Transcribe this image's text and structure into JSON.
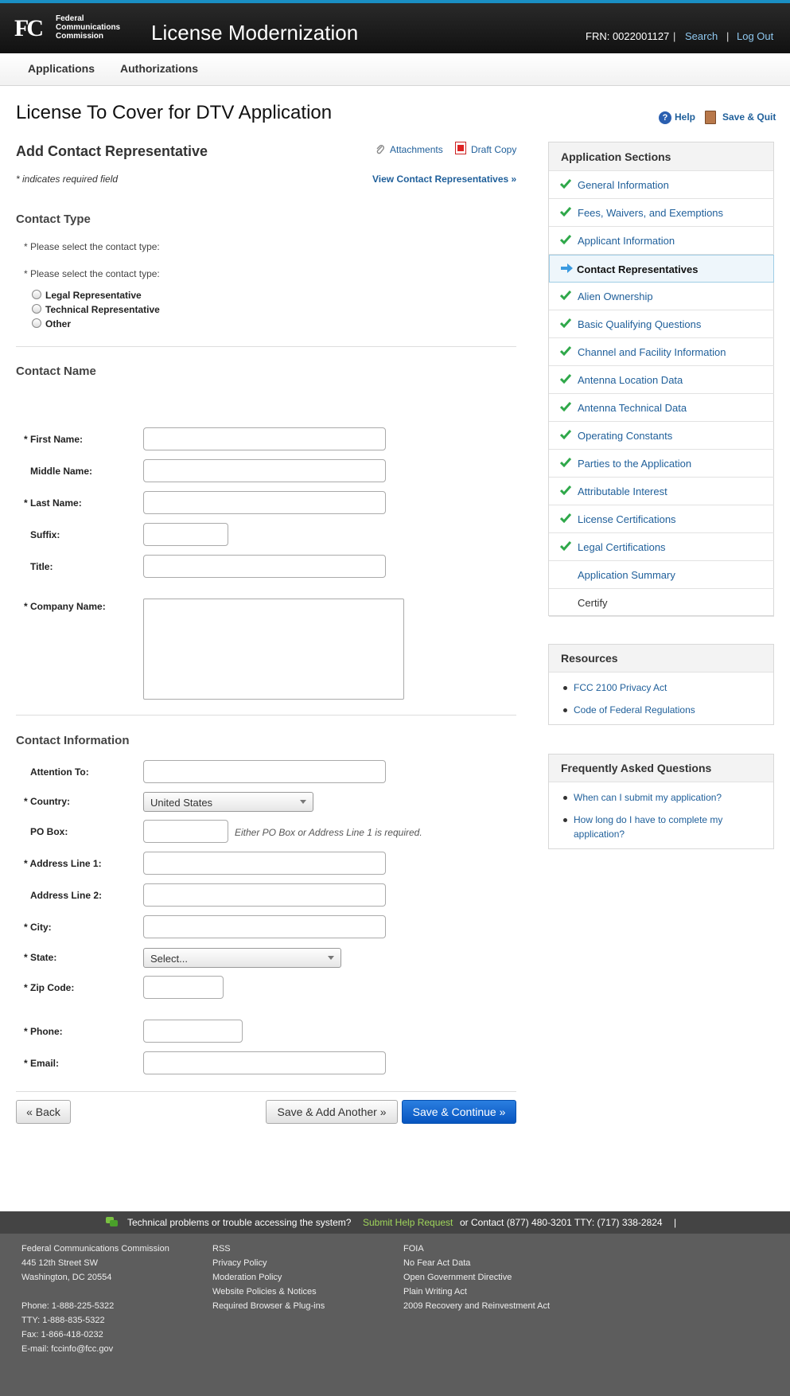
{
  "header": {
    "logo_mark": "FC",
    "logo_text": [
      "Federal",
      "Communications",
      "Commission"
    ],
    "app_title": "License Modernization",
    "frn": "FRN: 0022001127",
    "separator": "|",
    "search": "Search",
    "logout": "Log Out"
  },
  "nav": {
    "applications": "Applications",
    "authorizations": "Authorizations"
  },
  "page": {
    "title": "License To Cover for DTV Application",
    "help": "Help",
    "save_quit": "Save & Quit"
  },
  "form": {
    "heading": "Add Contact Representative",
    "attachments": "Attachments",
    "draft_copy": "Draft Copy",
    "required_note": "* indicates required field",
    "view_reps": "View Contact Representatives »",
    "contact_type": {
      "title": "Contact Type",
      "prompt1": "* Please select the contact type:",
      "prompt2": "* Please select the contact type:",
      "options": [
        "Legal Representative",
        "Technical Representative",
        "Other"
      ]
    },
    "contact_name": {
      "title": "Contact Name",
      "first": "* First Name:",
      "middle": "Middle Name:",
      "last": "* Last Name:",
      "suffix": "Suffix:",
      "title_lbl": "Title:",
      "company": "* Company Name:"
    },
    "contact_info": {
      "title": "Contact Information",
      "attention": "Attention To:",
      "country": "* Country:",
      "country_value": "United States",
      "pobox": "PO Box:",
      "pobox_hint": "Either PO Box or Address Line 1 is required.",
      "addr1": "* Address Line 1:",
      "addr2": "Address Line 2:",
      "city": "* City:",
      "state": "* State:",
      "state_value": "Select...",
      "zip": "* Zip Code:",
      "phone": "* Phone:",
      "email": "* Email:"
    },
    "buttons": {
      "back": "« Back",
      "save_add": "Save & Add Another »",
      "save_continue": "Save & Continue »"
    }
  },
  "sidebar": {
    "sections_title": "Application Sections",
    "sections": [
      {
        "label": "General Information",
        "state": "done"
      },
      {
        "label": "Fees, Waivers, and Exemptions",
        "state": "done"
      },
      {
        "label": "Applicant Information",
        "state": "done"
      },
      {
        "label": "Contact Representatives",
        "state": "current"
      },
      {
        "label": "Alien Ownership",
        "state": "done"
      },
      {
        "label": "Basic Qualifying Questions",
        "state": "done"
      },
      {
        "label": "Channel and Facility Information",
        "state": "done"
      },
      {
        "label": "Antenna Location Data",
        "state": "done"
      },
      {
        "label": "Antenna Technical Data",
        "state": "done"
      },
      {
        "label": "Operating Constants",
        "state": "done"
      },
      {
        "label": "Parties to the Application",
        "state": "done"
      },
      {
        "label": "Attributable Interest",
        "state": "done"
      },
      {
        "label": "License Certifications",
        "state": "done"
      },
      {
        "label": "Legal Certifications",
        "state": "done"
      },
      {
        "label": "Application Summary",
        "state": "link"
      },
      {
        "label": "Certify",
        "state": "plain"
      }
    ],
    "resources_title": "Resources",
    "resources": [
      "FCC 2100 Privacy Act",
      "Code of Federal Regulations"
    ],
    "faq_title": "Frequently Asked Questions",
    "faq": [
      "When can I submit my application?",
      "How long do I have to complete my",
      "application?"
    ]
  },
  "footer": {
    "bar_text": "Technical problems or trouble accessing the system?",
    "submit_help": "Submit Help Request",
    "contact_text": "or Contact (877) 480-3201 TTY: (717) 338-2824",
    "bar_sep": "|",
    "col1": [
      "Federal Communications Commission",
      "445 12th Street SW",
      "Washington, DC 20554",
      "",
      "Phone: 1-888-225-5322",
      "TTY: 1-888-835-5322",
      "Fax: 1-866-418-0232",
      "E-mail: fccinfo@fcc.gov"
    ],
    "col2": [
      "RSS",
      "Privacy Policy",
      "Moderation Policy",
      "Website Policies & Notices",
      "Required Browser & Plug-ins"
    ],
    "col3": [
      "FOIA",
      "No Fear Act Data",
      "Open Government Directive",
      "Plain Writing Act",
      "2009 Recovery and Reinvestment Act"
    ]
  },
  "colors": {
    "link": "#1f5f9a",
    "primary_button": "#0755c0",
    "check": "#2fa84a",
    "header_bg": "#1a1a1a"
  },
  "icons": [
    "help-icon",
    "door-icon",
    "paperclip-icon",
    "pdf-icon",
    "check-icon",
    "arrow-right-icon",
    "chat-icon"
  ]
}
